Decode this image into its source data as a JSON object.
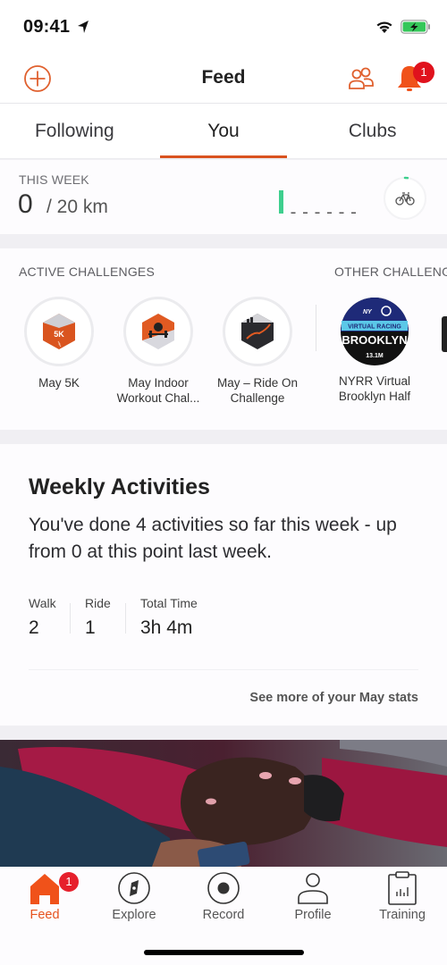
{
  "status_bar": {
    "time": "09:41",
    "icons": [
      "location-arrow-icon",
      "wifi-icon",
      "battery-charging-icon"
    ]
  },
  "nav": {
    "title": "Feed",
    "left_icon": "add-circle-icon",
    "right_icons": [
      "find-friends-icon",
      "notifications-bell-icon"
    ],
    "notification_count": "1"
  },
  "tabs": [
    {
      "label": "Following",
      "active": false
    },
    {
      "label": "You",
      "active": true
    },
    {
      "label": "Clubs",
      "active": false
    }
  ],
  "this_week": {
    "label": "THIS WEEK",
    "value": "0",
    "goal": "/ 20 km",
    "sport_icon": "bike-icon",
    "daily_bars": [
      1,
      0,
      0,
      0,
      0,
      0,
      0
    ],
    "goal_progress": 0.02,
    "accent_color": "#3ecf8e"
  },
  "challenges": {
    "active_header": "ACTIVE CHALLENGES",
    "other_header": "OTHER CHALLENGES",
    "active": [
      {
        "label": "May 5K",
        "badge": "5k-badge"
      },
      {
        "label": "May Indoor Workout Chal...",
        "badge": "indoor-workout-badge"
      },
      {
        "label": "May – Ride On Challenge",
        "badge": "ride-on-badge"
      }
    ],
    "other": [
      {
        "label": "NYRR Virtual Brooklyn Half",
        "badge": "nyrr-brooklyn-badge",
        "badge_text": [
          "VIRTUAL RACING",
          "BROOKLYN",
          "13.1M"
        ]
      }
    ]
  },
  "weekly_activities": {
    "title": "Weekly Activities",
    "description": "You've done 4 activities so far this week - up from 0 at this point last week.",
    "stats": [
      {
        "label": "Walk",
        "value": "2"
      },
      {
        "label": "Ride",
        "value": "1"
      },
      {
        "label": "Total Time",
        "value": "3h 4m"
      }
    ],
    "link": "See more of your May stats"
  },
  "tabbar": {
    "items": [
      {
        "label": "Feed",
        "icon": "home-icon",
        "active": true,
        "badge": "1"
      },
      {
        "label": "Explore",
        "icon": "compass-icon",
        "active": false
      },
      {
        "label": "Record",
        "icon": "record-icon",
        "active": false
      },
      {
        "label": "Profile",
        "icon": "profile-icon",
        "active": false
      },
      {
        "label": "Training",
        "icon": "training-clipboard-icon",
        "active": false
      }
    ]
  },
  "colors": {
    "brand": "#e6531f",
    "badge_red": "#e0121d",
    "progress_green": "#3ecf8e"
  }
}
